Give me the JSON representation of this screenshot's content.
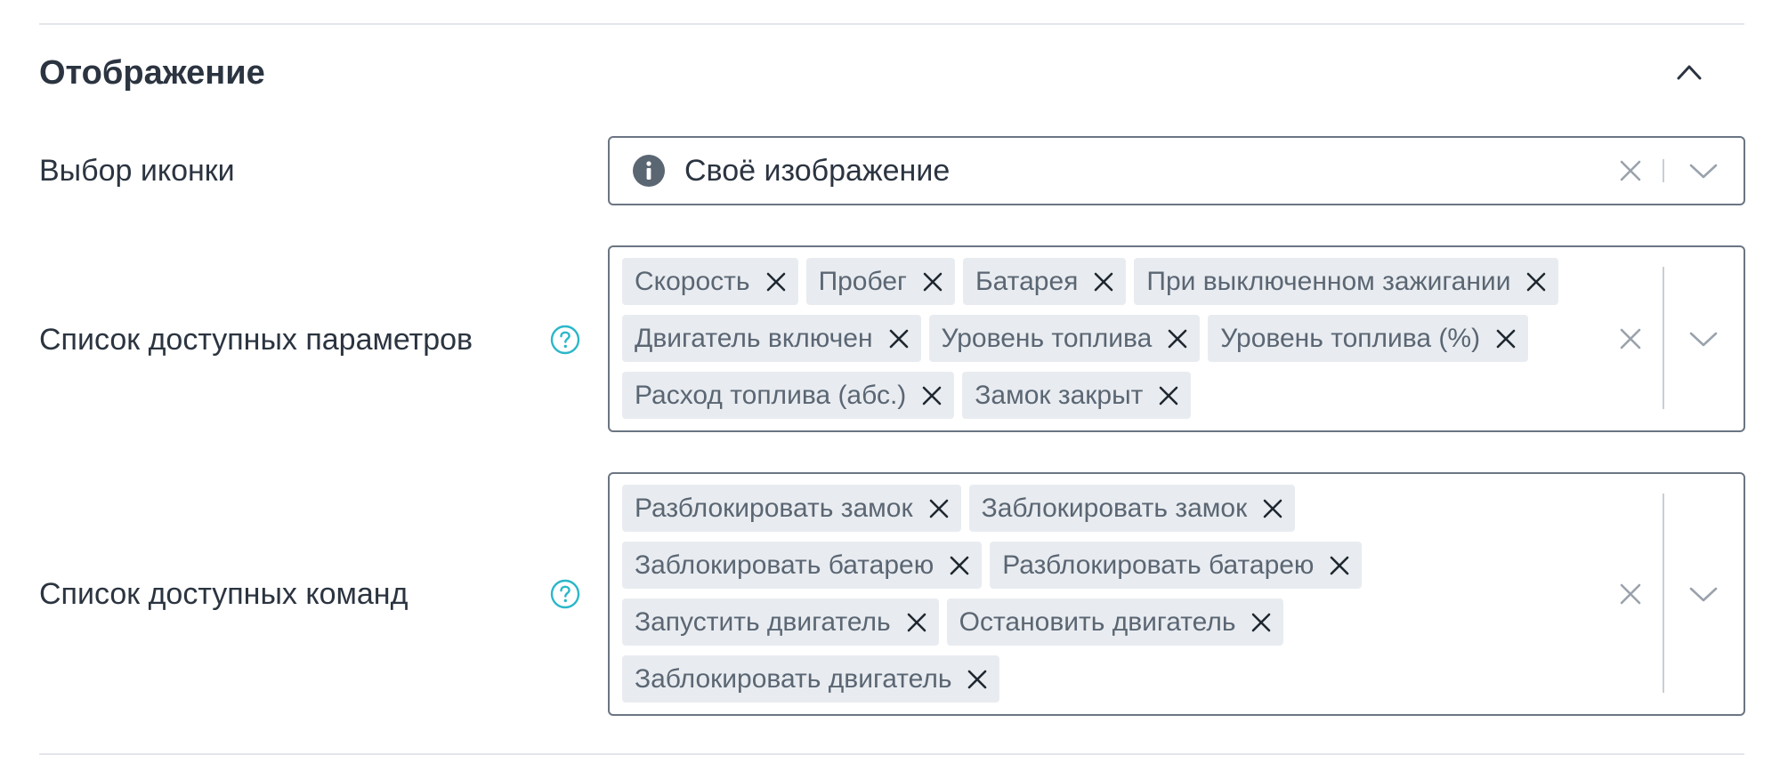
{
  "section": {
    "title": "Отображение"
  },
  "icon_select": {
    "label": "Выбор иконки",
    "value": "Своё изображение"
  },
  "params_select": {
    "label": "Список доступных параметров",
    "tags": [
      "Скорость",
      "Пробег",
      "Батарея",
      "При выключенном зажигании",
      "Двигатель включен",
      "Уровень топлива",
      "Уровень топлива (%)",
      "Расход топлива (абс.)",
      "Замок закрыт"
    ]
  },
  "commands_select": {
    "label": "Список доступных команд",
    "tags": [
      "Разблокировать замок",
      "Заблокировать замок",
      "Заблокировать батарею",
      "Разблокировать батарею",
      "Запустить двигатель",
      "Остановить двигатель",
      "Заблокировать двигатель"
    ]
  },
  "colors": {
    "text": "#2b3440",
    "tag_bg": "#e8ecf0",
    "tag_text": "#5b6673",
    "help_accent": "#2bb7c9",
    "field_border": "#6b7583",
    "control_gray": "#9aa2ac"
  },
  "icons": {
    "collapse": "chevron-up-icon",
    "info": "info-icon",
    "help": "question-circle-icon",
    "clear": "close-icon",
    "dropdown": "chevron-down-icon",
    "tag_remove": "close-icon"
  }
}
